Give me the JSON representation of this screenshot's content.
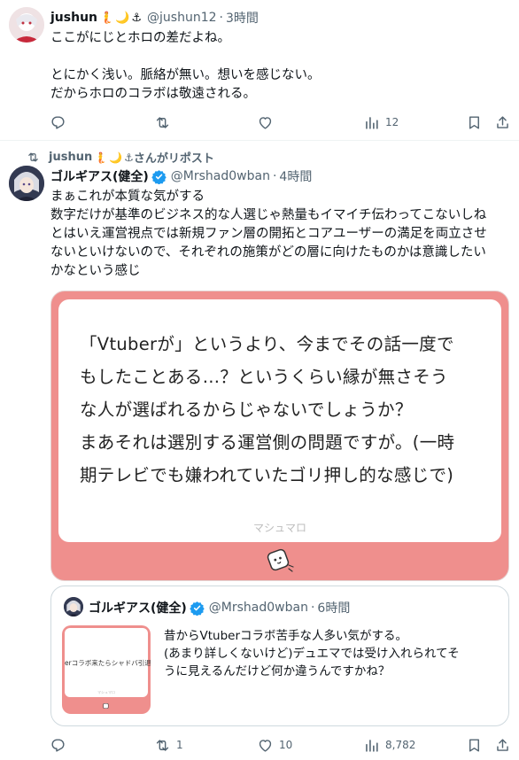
{
  "tweet1": {
    "display_name": "jushun",
    "name_emojis": [
      "🧜",
      "🌙",
      "⚓"
    ],
    "handle": "@jushun12",
    "time": "3時間",
    "lines": [
      "ここがにじとホロの差だよね。",
      "",
      "とにかく浅い。脈絡が無い。想いを感じない。",
      "だからホロのコラボは敬遠される。"
    ],
    "views": "12"
  },
  "repost_notice": {
    "user": "jushun",
    "emojis": [
      "🧜",
      "🌙",
      "⚓"
    ],
    "suffix": "さんがリポスト"
  },
  "tweet2": {
    "display_name": "ゴルギアス(健全)",
    "handle": "@Mrshad0wban",
    "time": "4時間",
    "lines": [
      "まぁこれが本質な気がする",
      "数字だけが基準のビジネス的な人選じゃ熱量もイマイチ伝わってこないしね",
      "とはいえ運営視点では新規ファン層の開拓とコアユーザーの満足を両立させ",
      "ないといけないので、それぞれの施策がどの層に向けたものかは意識したい",
      "かなという感じ"
    ],
    "marshmallow": {
      "lines": [
        "「Vtuberが」というより、今までその話一度で",
        "もしたことある…？というくらい縁が無さそう",
        "な人が選ばれるからじゃないでしょうか？",
        "まあそれは選別する運営側の問題ですが。(一時",
        "期テレビでも嫌われていたゴリ押し的な感じで)"
      ],
      "brand": "マシュマロ"
    },
    "quote": {
      "display_name": "ゴルギアス(健全)",
      "handle": "@Mrshad0wban",
      "time": "6時間",
      "lines": [
        "昔からVtuberコラボ苦手な人多い気がする。",
        "(あまり詳しくないけど)デュエマでは受け入れられてそ",
        "うに見えるんだけど何か違うんですかね？"
      ],
      "thumb_text": "erコラボ来たらシャドバ引退し",
      "thumb_brand": "マシュマロ"
    },
    "retweets": "1",
    "likes": "10",
    "views": "8,782"
  },
  "colors": {
    "accent": "#1d9bf0",
    "muted": "#536471",
    "marshmallow_pink": "#ef8f8d"
  },
  "icons": [
    "reply-icon",
    "retweet-icon",
    "like-icon",
    "views-icon",
    "bookmark-icon",
    "share-icon",
    "verified-icon",
    "repost-icon",
    "marshmallow-logo"
  ]
}
